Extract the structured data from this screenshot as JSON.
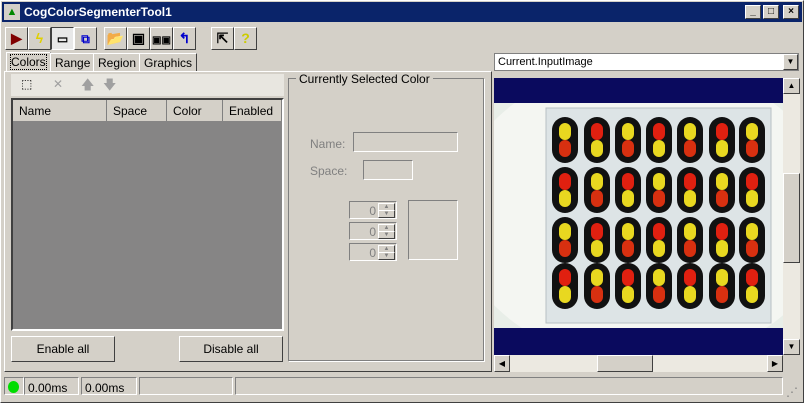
{
  "window": {
    "title": "CogColorSegmenterTool1",
    "controls": [
      "minimize",
      "maximize",
      "close"
    ]
  },
  "toolbar": {
    "buttons": [
      {
        "name": "run-button",
        "icon": "play-icon"
      },
      {
        "name": "electric-button",
        "icon": "lightning-icon"
      },
      {
        "name": "show-properties-button",
        "icon": "window-icon"
      },
      {
        "name": "floating-window-button",
        "icon": "windows-icon"
      },
      {
        "name": "open-button",
        "icon": "folder-open-icon"
      },
      {
        "name": "save-button",
        "icon": "floppy-icon"
      },
      {
        "name": "save-as-button",
        "icon": "floppy-pair-icon"
      },
      {
        "name": "reset-button",
        "icon": "reset-arrow-icon"
      },
      {
        "name": "pointer-button",
        "icon": "pointer-ruler-icon"
      },
      {
        "name": "help-button",
        "icon": "help-icon"
      }
    ]
  },
  "tabs": [
    {
      "label": "Colors",
      "active": true
    },
    {
      "label": "Range"
    },
    {
      "label": "Region"
    },
    {
      "label": "Graphics"
    }
  ],
  "colors_panel": {
    "columns": [
      "Name",
      "Space",
      "Color",
      "Enabled"
    ],
    "rows": [],
    "enable_all": "Enable all",
    "disable_all": "Disable all"
  },
  "selected_color": {
    "group_label": "Currently Selected Color",
    "name_label": "Name:",
    "name_value": "",
    "space_label": "Space:",
    "space_value": "",
    "channels": [
      "0",
      "0",
      "0"
    ]
  },
  "image_view": {
    "selector_value": "Current.InputImage",
    "background": "#0a0a5e"
  },
  "status_bar": {
    "indicator_color": "#00dd00",
    "time1": "0.00ms",
    "time2": "0.00ms"
  }
}
